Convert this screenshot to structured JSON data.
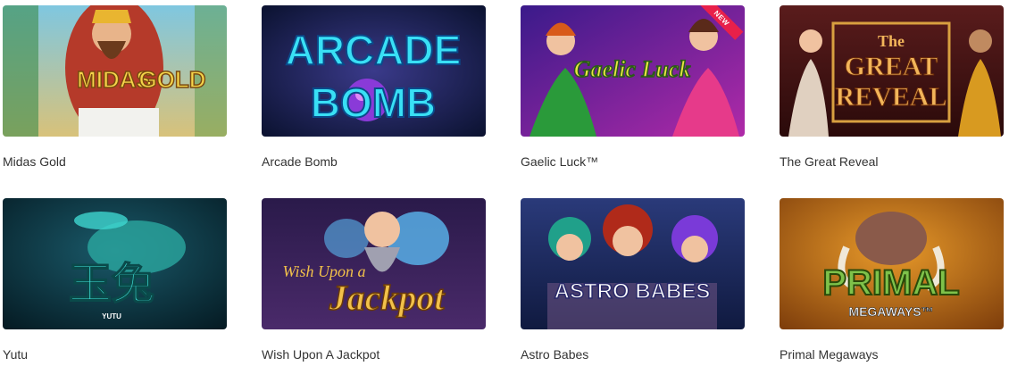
{
  "games": [
    {
      "title": "Midas Gold",
      "art_line1": "MIDAS",
      "art_line2": "GOLD",
      "colors": [
        "#69b7d6",
        "#f0c64a"
      ]
    },
    {
      "title": "Arcade Bomb",
      "art_line1": "ARCADE",
      "art_line2": "BOMB",
      "colors": [
        "#1a2a55",
        "#35d8f0"
      ]
    },
    {
      "title": "Gaelic Luck™",
      "art_line1": "Gaelic Luck",
      "badge": "NEW",
      "colors": [
        "#6a1fa8",
        "#e6e53a"
      ]
    },
    {
      "title": "The Great Reveal",
      "art_line1": "The",
      "art_line2": "GREAT",
      "art_line3": "REVEAL",
      "colors": [
        "#4a1417",
        "#f2b55a"
      ]
    },
    {
      "title": "Yutu",
      "art_line1": "玉兔",
      "art_line2": "YUTU",
      "colors": [
        "#0a2b3a",
        "#3fd6d0"
      ]
    },
    {
      "title": "Wish Upon A Jackpot",
      "art_line1": "Wish Upon a",
      "art_line2": "Jackpot",
      "colors": [
        "#2c1a4f",
        "#f2c14a"
      ]
    },
    {
      "title": "Astro Babes",
      "art_line1": "ASTRO BABES",
      "colors": [
        "#1d2c5d",
        "#ffffff"
      ]
    },
    {
      "title": "Primal Megaways",
      "art_line1": "PRIMAL",
      "art_line2": "MEGAWAYS™",
      "colors": [
        "#c86a12",
        "#7ec24a"
      ]
    }
  ]
}
